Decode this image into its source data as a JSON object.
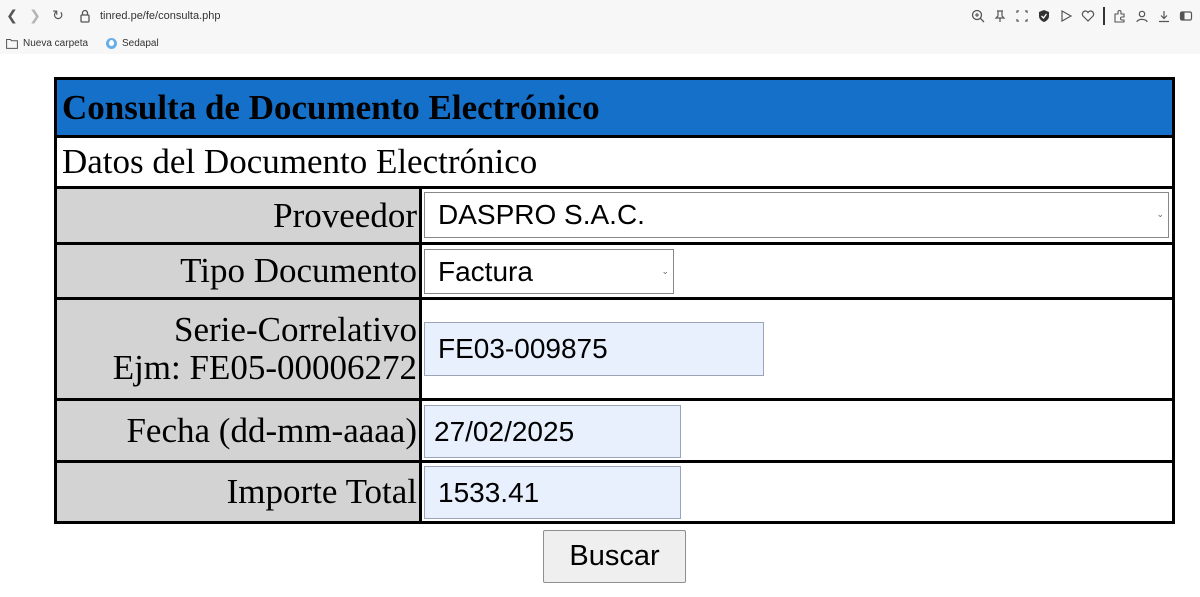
{
  "browser": {
    "url": "tinred.pe/fe/consulta.php",
    "bookmarks": [
      {
        "label": "Nueva carpeta",
        "icon": "folder-icon"
      },
      {
        "label": "Sedapal",
        "icon": "sedapal-drop-icon"
      }
    ],
    "toolbar_icons": [
      "zoom-icon",
      "pin-icon",
      "screenshot-icon",
      "shield-icon",
      "play-icon",
      "heart-icon",
      "extensions-icon",
      "profile-icon",
      "download-icon",
      "sidebar-icon"
    ]
  },
  "form": {
    "title": "Consulta de Documento Electrónico",
    "subtitle": "Datos del Documento Electrónico",
    "fields": {
      "proveedor": {
        "label": "Proveedor",
        "value": "DASPRO S.A.C."
      },
      "tipo_documento": {
        "label": "Tipo Documento",
        "value": "Factura"
      },
      "serie": {
        "label_line1": "Serie-Correlativo",
        "label_line2": "Ejm: FE05-00006272",
        "value": "FE03-009875"
      },
      "fecha": {
        "label": "Fecha (dd-mm-aaaa)",
        "value": "27/02/2025"
      },
      "importe": {
        "label": "Importe Total",
        "value": "1533.41"
      }
    },
    "submit_label": "Buscar"
  },
  "colors": {
    "title_bg": "#1570c9",
    "label_bg": "#d3d3d3",
    "autofill_bg": "#e8f0fe"
  }
}
